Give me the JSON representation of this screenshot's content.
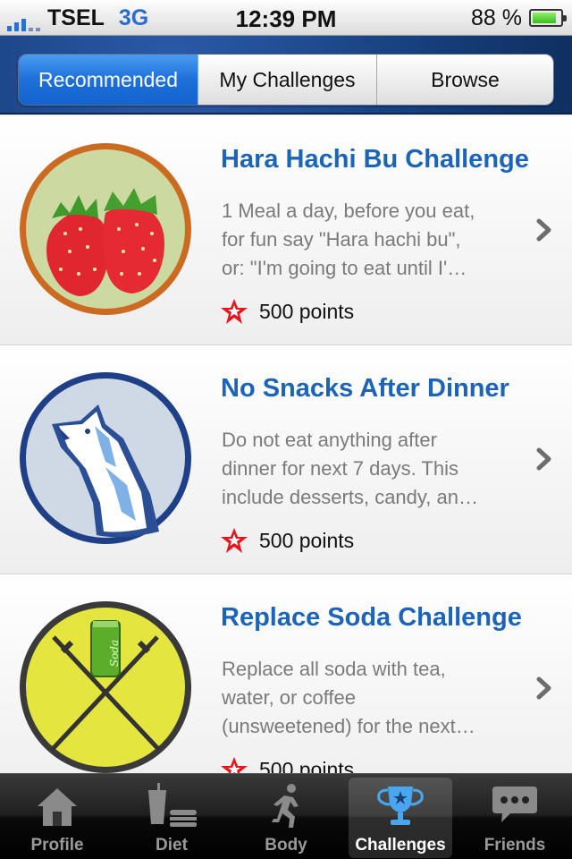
{
  "status_bar": {
    "carrier": "TSEL",
    "network": "3G",
    "time": "12:39 PM",
    "battery": "88 %",
    "battery_level": 0.88
  },
  "segments": [
    {
      "label": "Recommended",
      "active": true
    },
    {
      "label": "My Challenges",
      "active": false
    },
    {
      "label": "Browse",
      "active": false
    }
  ],
  "challenges": [
    {
      "title": "Hara Hachi Bu Challenge",
      "desc_lines": [
        "1 Meal a day, before you eat,",
        "for fun say \"Hara hachi bu\",",
        "or: \"I'm going to eat until I'…"
      ],
      "points": "500 points",
      "badge_icon": "strawberry-badge-icon"
    },
    {
      "title": "No Snacks After Dinner",
      "desc_lines": [
        "Do not eat anything after",
        "dinner for next 7 days. This",
        "include desserts, candy, an…"
      ],
      "points": "500 points",
      "badge_icon": "wolf-badge-icon"
    },
    {
      "title": "Replace Soda Challenge",
      "desc_lines": [
        "Replace all soda with tea,",
        "water, or coffee",
        "(unsweetened) for the next…"
      ],
      "points": "500 points",
      "badge_icon": "soda-badge-icon",
      "can_text": "Soda"
    }
  ],
  "tabs": [
    {
      "label": "Profile",
      "icon": "house-icon"
    },
    {
      "label": "Diet",
      "icon": "food-icon"
    },
    {
      "label": "Body",
      "icon": "runner-icon"
    },
    {
      "label": "Challenges",
      "icon": "trophy-icon",
      "active": true
    },
    {
      "label": "Friends",
      "icon": "chat-bubble-icon"
    }
  ],
  "colors": {
    "accent": "#1b64b8",
    "segment_active": "#1d6fda",
    "star": "#e8131b"
  }
}
